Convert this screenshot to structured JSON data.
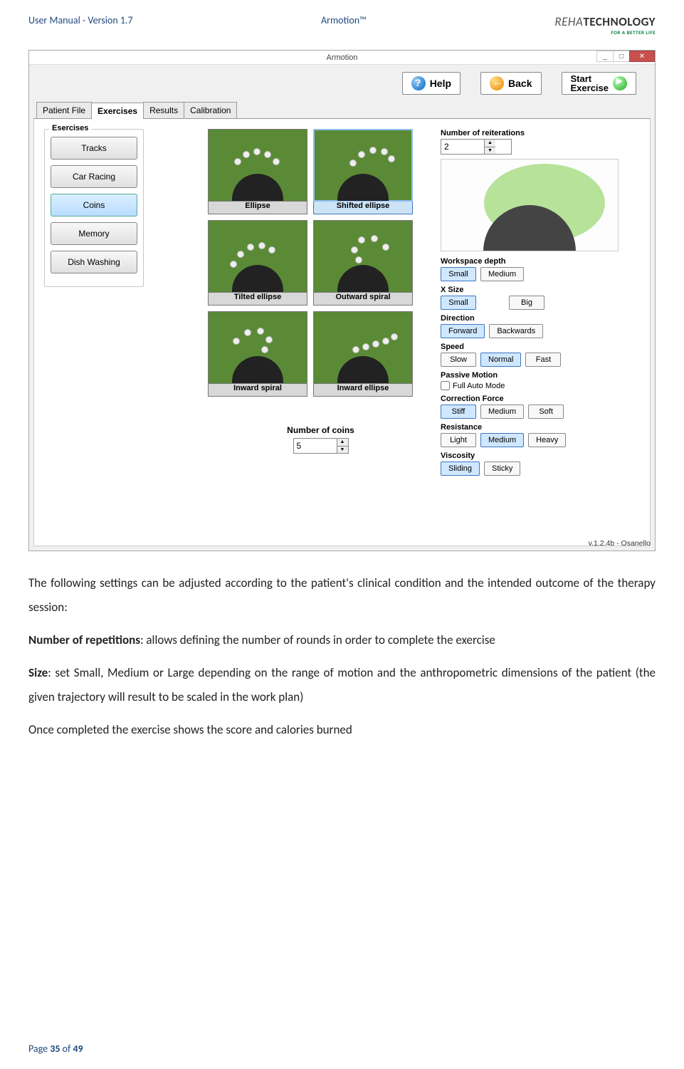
{
  "header": {
    "left": "User Manual - Version 1.7",
    "center": "Armotion™",
    "logo_top": "REHA",
    "logo_main": "TECHNOLOGY",
    "logo_sub": "FOR A BETTER LIFE"
  },
  "footer": {
    "pre": "Page ",
    "cur": "35",
    "mid": " of ",
    "total": "49"
  },
  "win": {
    "title": "Armotion",
    "btn_help": "Help",
    "btn_back": "Back",
    "btn_start_l1": "Start",
    "btn_start_l2": "Exercise",
    "tab_patient": "Patient File",
    "tab_ex": "Exercises",
    "tab_res": "Results",
    "tab_cal": "Calibration",
    "ex_group": "Esercises",
    "ex": {
      "tracks": "Tracks",
      "car": "Car Racing",
      "coins": "Coins",
      "mem": "Memory",
      "dish": "Dish Washing"
    },
    "tile": {
      "a": "Ellipse",
      "b": "Shifted ellipse",
      "c": "Tilted ellipse",
      "d": "Outward spiral",
      "e": "Inward spiral",
      "f": "Inward ellipse"
    },
    "coins_lbl": "Number of coins",
    "coins_val": "5",
    "r": {
      "reit_lbl": "Number of reiterations",
      "reit_val": "2",
      "depth_lbl": "Workspace depth",
      "depth_a": "Small",
      "depth_b": "Medium",
      "xsize_lbl": "X Size",
      "xsize_a": "Small",
      "xsize_b": "Big",
      "dir_lbl": "Direction",
      "dir_a": "Forward",
      "dir_b": "Backwards",
      "speed_lbl": "Speed",
      "speed_a": "Slow",
      "speed_b": "Normal",
      "speed_c": "Fast",
      "pm_lbl": "Passive Motion",
      "pm_chk": "Full Auto Mode",
      "cf_lbl": "Correction Force",
      "cf_a": "Stiff",
      "cf_b": "Medium",
      "cf_c": "Soft",
      "res_lbl": "Resistance",
      "res_a": "Light",
      "res_b": "Medium",
      "res_c": "Heavy",
      "vis_lbl": "Viscosity",
      "vis_a": "Sliding",
      "vis_b": "Sticky"
    },
    "ver": "v.1.2.4b - Osanello"
  },
  "text": {
    "p1": "The following settings can be adjusted according to the patient's clinical condition and the intended outcome of the therapy session:",
    "p2a": "Number of repetitions",
    "p2b": ": allows defining the number of rounds in order to complete the exercise",
    "p3a": "Size",
    "p3b": ": set Small, Medium or Large depending on the range of motion and the anthropometric dimensions of the patient (the given trajectory will result to be scaled in the work plan)",
    "p4": "Once completed the exercise shows the score and calories burned"
  }
}
